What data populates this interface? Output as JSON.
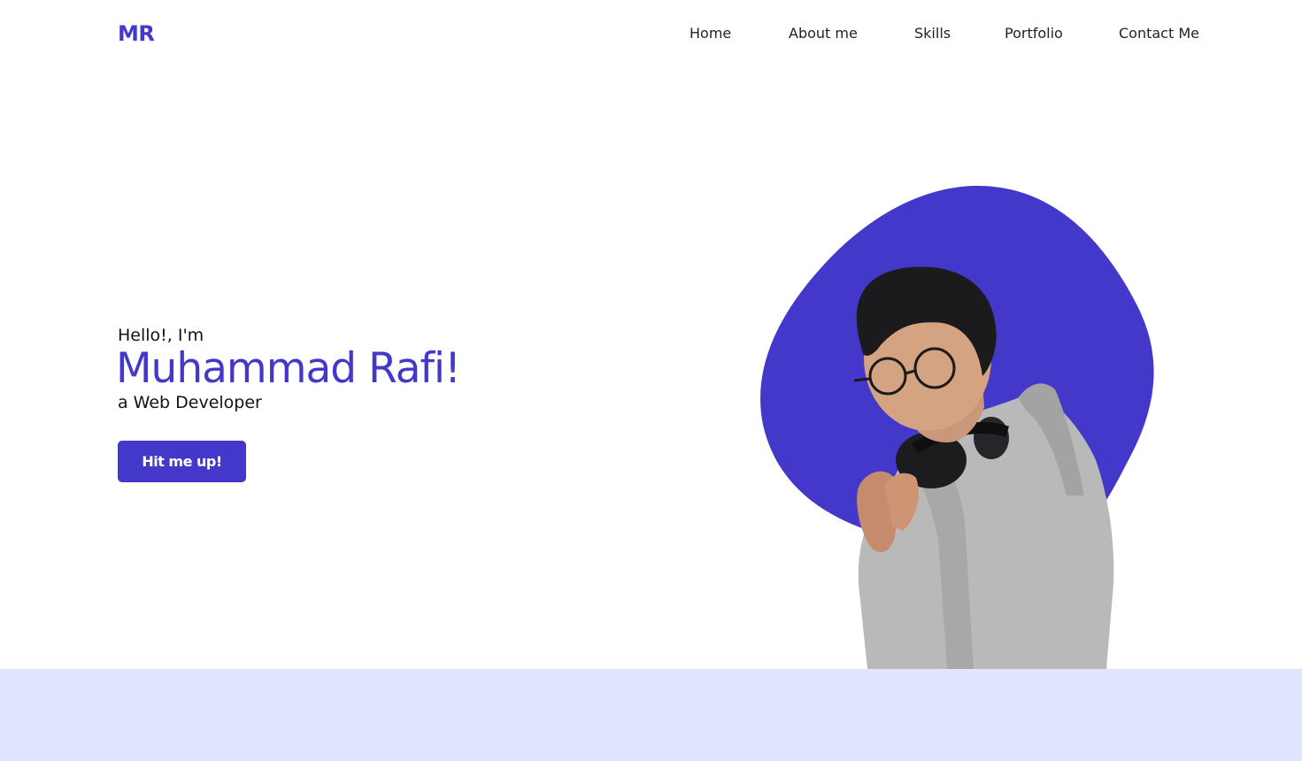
{
  "header": {
    "logo": "MR",
    "nav": [
      {
        "label": "Home"
      },
      {
        "label": "About me"
      },
      {
        "label": "Skills"
      },
      {
        "label": "Portfolio"
      },
      {
        "label": "Contact Me"
      }
    ]
  },
  "hero": {
    "greeting": "Hello!, I'm",
    "name": "Muhammad Rafi!",
    "role": "a Web Developer",
    "cta_label": "Hit me up!"
  },
  "colors": {
    "accent": "#4338ca",
    "text": "#111118",
    "band": "#e0e5ff",
    "background": "#ffffff"
  }
}
